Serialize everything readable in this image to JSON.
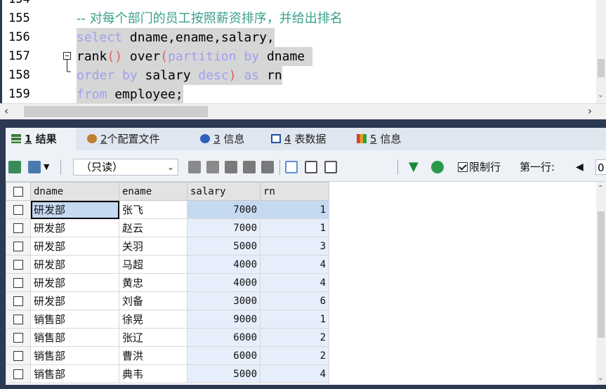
{
  "editor": {
    "lines": [
      {
        "num": "154",
        "segments": []
      },
      {
        "num": "155",
        "segments": [
          {
            "t": "-- 对每个部门的员工按照薪资排序，并给出排名",
            "c": "cm"
          }
        ],
        "hl": false
      },
      {
        "num": "156",
        "segments": [
          {
            "t": "select",
            "c": "kw"
          },
          {
            "t": " dname,ename,salary,",
            "c": "fn"
          }
        ],
        "hl": true
      },
      {
        "num": "157",
        "segments": [
          {
            "t": "rank",
            "c": "fn"
          },
          {
            "t": "()",
            "c": "pn"
          },
          {
            "t": " over",
            "c": "fn"
          },
          {
            "t": "(",
            "c": "pn"
          },
          {
            "t": "partition by",
            "c": "kw"
          },
          {
            "t": " dname ",
            "c": "fn"
          }
        ],
        "hl": true,
        "fold": "minus"
      },
      {
        "num": "158",
        "segments": [
          {
            "t": "order by",
            "c": "kw"
          },
          {
            "t": " salary ",
            "c": "fn"
          },
          {
            "t": "desc",
            "c": "kw"
          },
          {
            "t": ")",
            "c": "pn"
          },
          {
            "t": " ",
            "c": "fn"
          },
          {
            "t": "as",
            "c": "kw"
          },
          {
            "t": " rn",
            "c": "fn"
          }
        ],
        "hl": true,
        "fold": "end"
      },
      {
        "num": "159",
        "segments": [
          {
            "t": "from",
            "c": "kw"
          },
          {
            "t": " employee;",
            "c": "fn"
          }
        ],
        "hl": true
      }
    ]
  },
  "tabs": [
    {
      "num": "1",
      "label": "结果",
      "active": true,
      "icon": "result-grid-icon",
      "color": "#3a7a3a"
    },
    {
      "num": "2",
      "label": "个配置文件",
      "active": false,
      "icon": "profile-icon",
      "color": "#c08030"
    },
    {
      "num": "3",
      "label": "信息",
      "active": false,
      "icon": "info-icon",
      "color": "#3060c0"
    },
    {
      "num": "4",
      "label": "表数据",
      "active": false,
      "icon": "table-data-icon",
      "color": "#2050a0"
    },
    {
      "num": "5",
      "label": "信息",
      "active": false,
      "icon": "info-bars-icon",
      "color": "#d04030"
    }
  ],
  "toolbar": {
    "mode": "（只读）",
    "limit_label": "限制行",
    "first_row_label": "第一行:",
    "first_row_value": "0"
  },
  "grid": {
    "columns": [
      "dname",
      "ename",
      "salary",
      "rn"
    ],
    "rows": [
      [
        "研发部",
        "张飞",
        "7000",
        "1"
      ],
      [
        "研发部",
        "赵云",
        "7000",
        "1"
      ],
      [
        "研发部",
        "关羽",
        "5000",
        "3"
      ],
      [
        "研发部",
        "马超",
        "4000",
        "4"
      ],
      [
        "研发部",
        "黄忠",
        "4000",
        "4"
      ],
      [
        "研发部",
        "刘备",
        "3000",
        "6"
      ],
      [
        "销售部",
        "徐晃",
        "9000",
        "1"
      ],
      [
        "销售部",
        "张辽",
        "6000",
        "2"
      ],
      [
        "销售部",
        "曹洪",
        "6000",
        "2"
      ],
      [
        "销售部",
        "典韦",
        "5000",
        "4"
      ]
    ],
    "selected_row": 0
  }
}
